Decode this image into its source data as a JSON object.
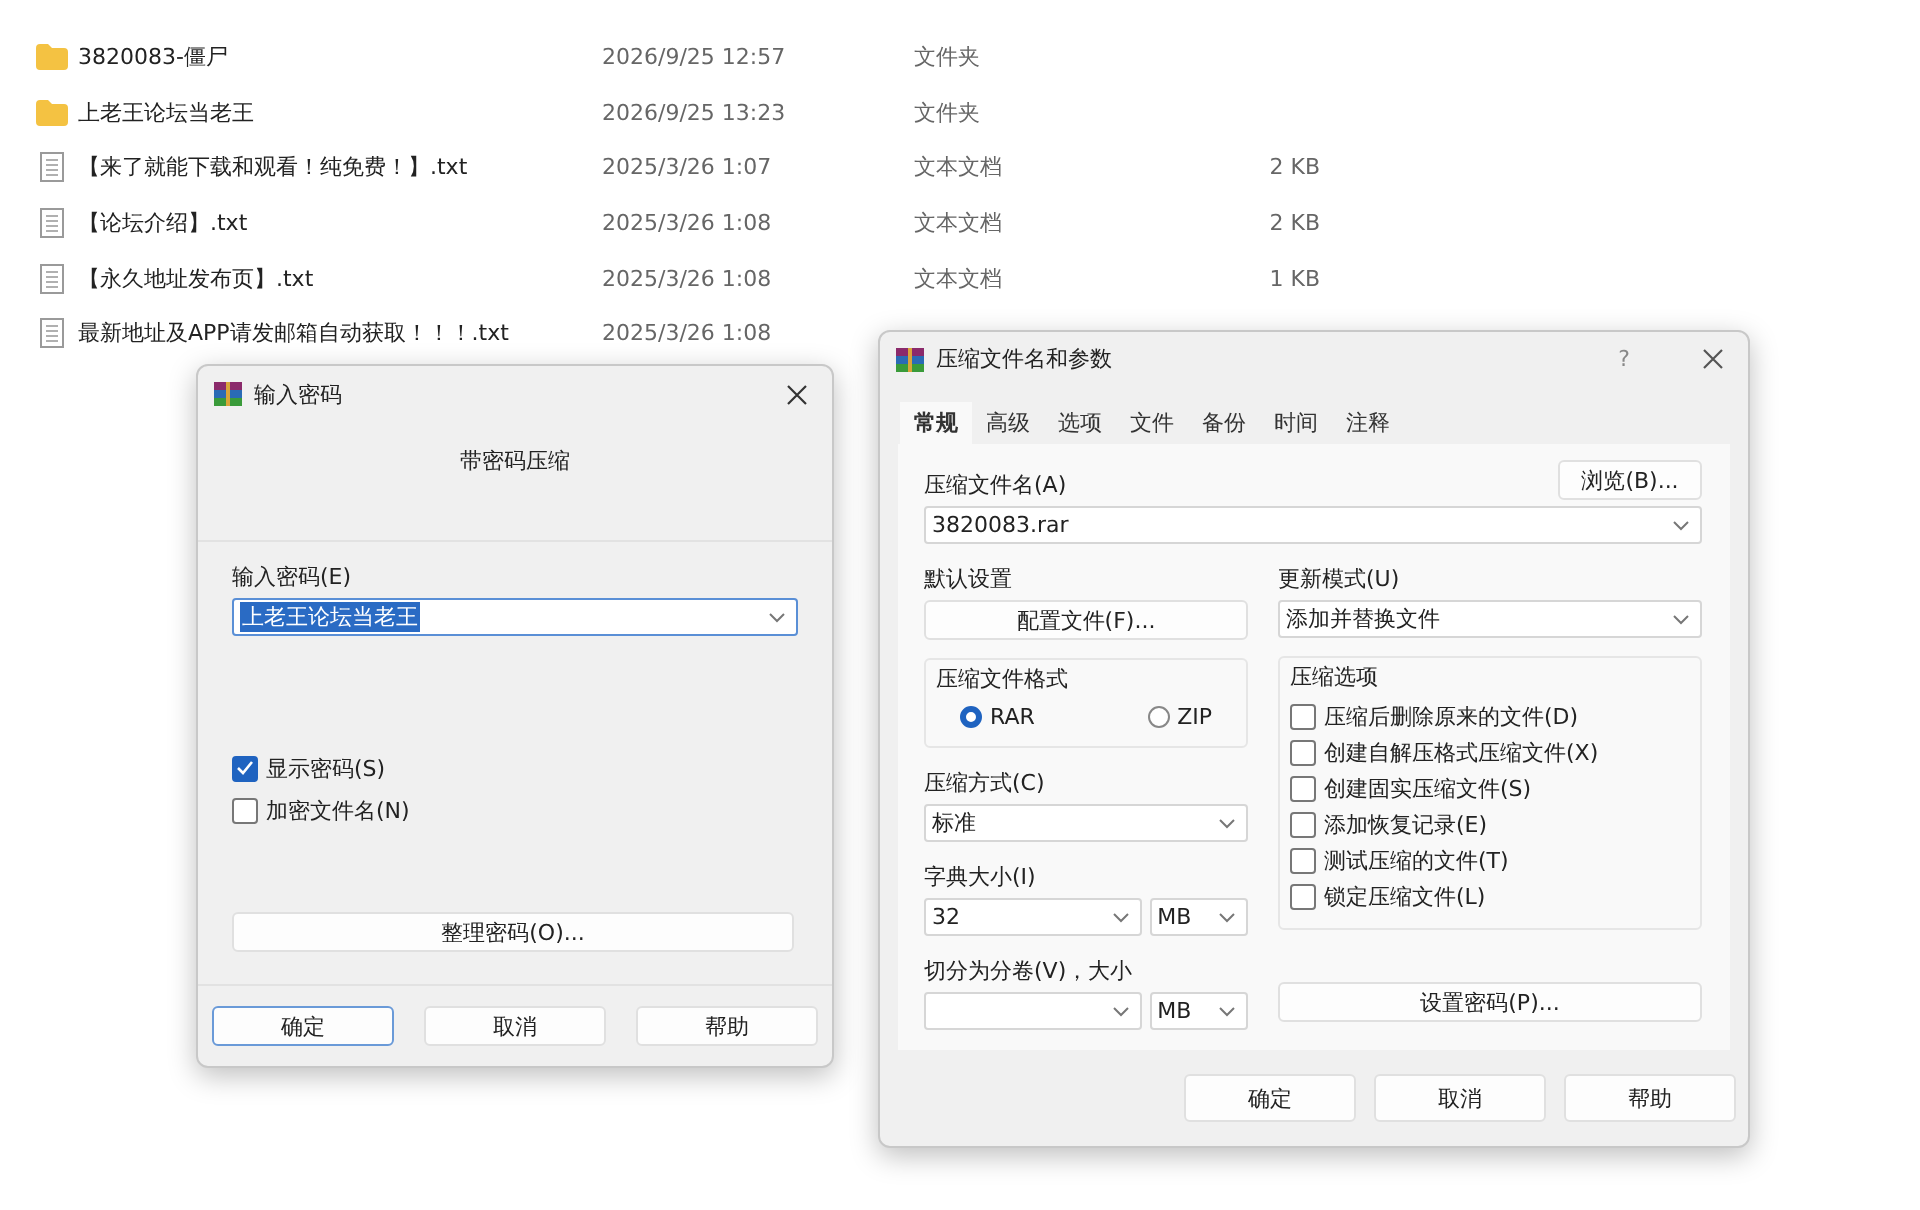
{
  "explorer": {
    "rows": [
      {
        "kind": "folder",
        "name": "3820083-僵尸",
        "date": "2026/9/25 12:57",
        "type": "文件夹"
      },
      {
        "kind": "folder",
        "name": "上老王论坛当老王",
        "date": "2026/9/25 13:23",
        "type": "文件夹"
      },
      {
        "kind": "file",
        "name": "【来了就能下载和观看！纯免费！】.txt",
        "date": "2025/3/26 1:07",
        "type": "文本文档",
        "size": "2 KB"
      },
      {
        "kind": "file",
        "name": "【论坛介绍】.txt",
        "date": "2025/3/26 1:08",
        "type": "文本文档",
        "size": "2 KB"
      },
      {
        "kind": "file",
        "name": "【永久地址发布页】.txt",
        "date": "2025/3/26 1:08",
        "type": "文本文档",
        "size": "1 KB"
      },
      {
        "kind": "file",
        "name": "最新地址及APP请发邮箱自动获取！！！.txt",
        "date": "2025/3/26 1:08"
      }
    ]
  },
  "password_dialog": {
    "title": "输入密码",
    "subtitle": "带密码压缩",
    "field_label": "输入密码(E)",
    "value": "上老王论坛当老王",
    "checkboxes": [
      {
        "label": "显示密码(S)",
        "checked": true
      },
      {
        "label": "加密文件名(N)",
        "checked": false
      }
    ],
    "organize_button": "整理密码(O)...",
    "buttons": [
      "确定",
      "取消",
      "帮助"
    ]
  },
  "archive_dialog": {
    "title": "压缩文件名和参数",
    "help": "?",
    "tabs": [
      {
        "label": "常规",
        "selected": true
      },
      {
        "label": "高级",
        "selected": false
      },
      {
        "label": "选项",
        "selected": false
      },
      {
        "label": "文件",
        "selected": false
      },
      {
        "label": "备份",
        "selected": false
      },
      {
        "label": "时间",
        "selected": false
      },
      {
        "label": "注释",
        "selected": false
      }
    ],
    "name_label": "压缩文件名(A)",
    "browse_button": "浏览(B)...",
    "name_value": "3820083.rar",
    "defaults_label": "默认设置",
    "profiles_button": "配置文件(F)...",
    "update_label": "更新模式(U)",
    "update_value": "添加并替换文件",
    "format_label": "压缩文件格式",
    "formats": [
      {
        "label": "RAR",
        "selected": true
      },
      {
        "label": "ZIP",
        "selected": false
      }
    ],
    "options_label": "压缩选项",
    "options": [
      {
        "label": "压缩后删除原来的文件(D)",
        "checked": false
      },
      {
        "label": "创建自解压格式压缩文件(X)",
        "checked": false
      },
      {
        "label": "创建固实压缩文件(S)",
        "checked": false
      },
      {
        "label": "添加恢复记录(E)",
        "checked": false
      },
      {
        "label": "测试压缩的文件(T)",
        "checked": false
      },
      {
        "label": "锁定压缩文件(L)",
        "checked": false
      }
    ],
    "method_label": "压缩方式(C)",
    "method_value": "标准",
    "dict_label": "字典大小(I)",
    "dict_value": "32",
    "dict_unit": "MB",
    "split_label": "切分为分卷(V)，大小",
    "split_unit": "MB",
    "password_button": "设置密码(P)...",
    "buttons": [
      "确定",
      "取消",
      "帮助"
    ]
  }
}
